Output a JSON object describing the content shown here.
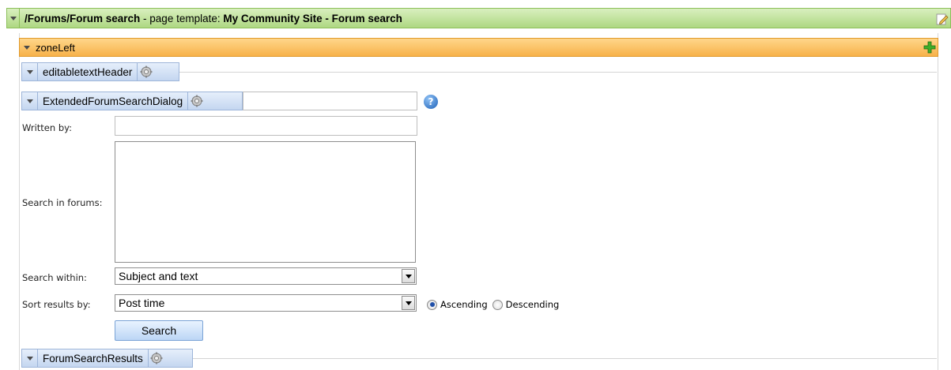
{
  "template_bar": {
    "path": "/Forums/Forum search",
    "sep": " - page template: ",
    "template_name": "My Community Site - Forum search"
  },
  "zone": {
    "label": "zoneLeft"
  },
  "webparts": {
    "header": {
      "label": "editabletextHeader"
    },
    "dialog": {
      "label": "ExtendedForumSearchDialog"
    },
    "results": {
      "label": "ForumSearchResults"
    }
  },
  "form": {
    "written_by_label": "Written by:",
    "written_by_value": "",
    "search_in_forums_label": "Search in forums:",
    "search_within_label": "Search within:",
    "search_within_value": "Subject and text",
    "sort_by_label": "Sort results by:",
    "sort_by_value": "Post time",
    "ascending_label": "Ascending",
    "descending_label": "Descending",
    "search_button": "Search"
  },
  "help_icon_glyph": "?",
  "colors": {
    "template_bar": "#aed882",
    "zone_bar": "#f7b24a",
    "webpart_bar": "#c4d6f0"
  }
}
